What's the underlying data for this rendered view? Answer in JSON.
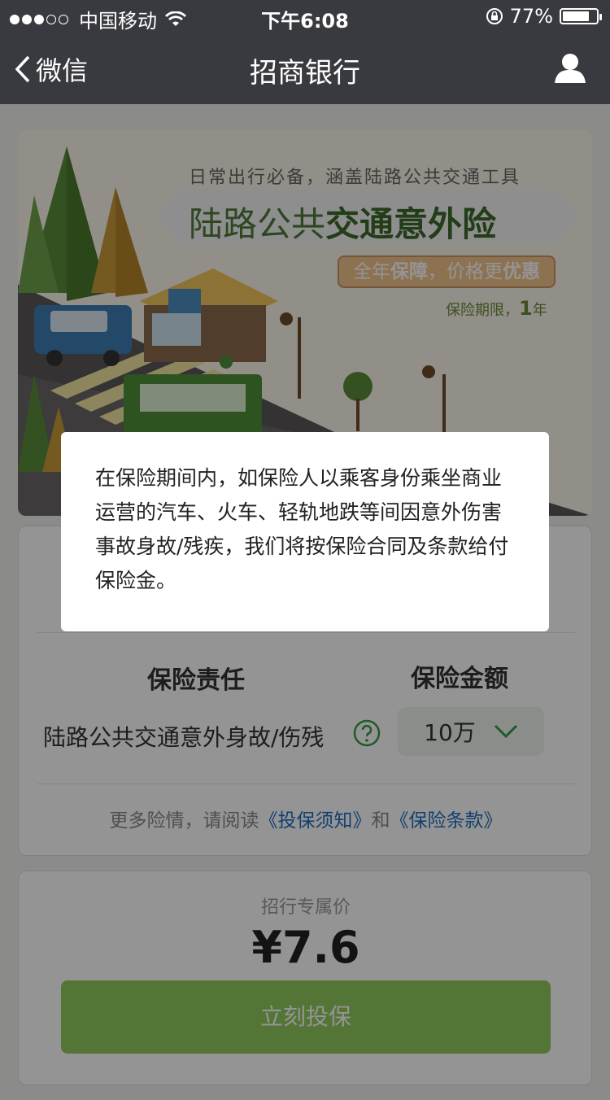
{
  "status_bar": {
    "carrier": "中国移动",
    "time": "下午6:08",
    "battery_pct": "77%"
  },
  "nav": {
    "back_label": "微信",
    "title": "招商银行",
    "icons": {
      "back": "chevron-left-icon",
      "user": "user-icon"
    }
  },
  "banner": {
    "subtitle": "日常出行必备，涵盖陆路公共交通工具",
    "title_part1": "陆路公共",
    "title_part2": "交通意外险",
    "pill_part1": "全年",
    "pill_part2": "保障",
    "pill_part3": "，价格更",
    "pill_part4": "优惠",
    "period_label": "保险期限，",
    "period_value": "1",
    "period_unit": "年"
  },
  "form": {
    "col_liability": "保险责任",
    "col_amount": "保险金额",
    "item_label": "陆路公共交通意外身故/伤残",
    "amount_value": "10万",
    "more_prefix": "更多险情，请阅读",
    "link_notice": "《投保须知》",
    "more_and": "和",
    "link_terms": "《保险条款》"
  },
  "price": {
    "label": "招行专属价",
    "value": "¥7.6",
    "buy_label": "立刻投保"
  },
  "dialog": {
    "text": "在保险期间内，如保险人以乘客身份乘坐商业运营的汽车、火车、轻轨地跌等间因意外伤害事故身故/残疾，我们将按保险合同及条款给付保险金。"
  },
  "colors": {
    "nav_bg": "#393a3f",
    "primary_green": "#8fca5d",
    "link_blue": "#1f6fbf",
    "banner_title_green": "#4e7a3a"
  }
}
